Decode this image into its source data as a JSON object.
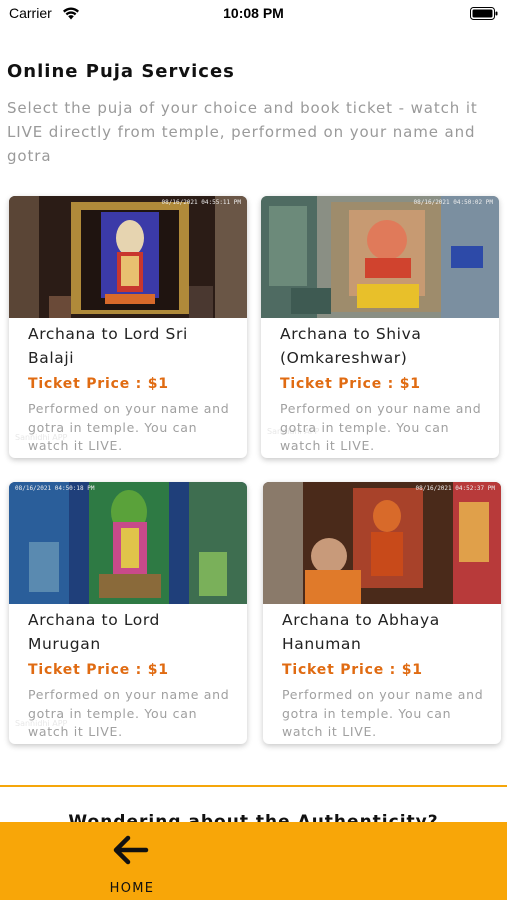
{
  "status_bar": {
    "carrier": "Carrier",
    "time": "10:08 PM"
  },
  "header": {
    "title": "Online Puja Services",
    "subtitle": "Select the puja of your choice and book ticket - watch it LIVE directly from temple, performed on your name and gotra"
  },
  "cards": [
    {
      "title": "Archana to Lord Sri Balaji",
      "price": "Ticket Price : $1",
      "description": "Performed on your name and gotra in temple. You can watch it LIVE.",
      "camera_stamp": "08/16/2021 04:55:11 PM",
      "camera_brand": "Sannidhi APP"
    },
    {
      "title": "Archana to Shiva (Omkareshwar)",
      "price": "Ticket Price : $1",
      "description": "Performed on your name and gotra in temple. You can watch it LIVE.",
      "camera_stamp": "08/16/2021 04:50:02 PM",
      "camera_brand": "Sannidhi APP"
    },
    {
      "title": "Archana to Lord Murugan",
      "price": "Ticket Price : $1",
      "description": "Performed on your name and gotra in temple. You can watch it LIVE.",
      "camera_stamp": "08/16/2021 04:50:18 PM",
      "camera_brand": "Sannidhi APP"
    },
    {
      "title": "Archana to Abhaya Hanuman",
      "price": "Ticket Price : $1",
      "description": "Performed on your name and gotra in temple. You can watch it LIVE.",
      "camera_stamp": "08/16/2021 04:52:37 PM",
      "camera_brand": ""
    }
  ],
  "section_peek": "Wondering about the Authenticity?",
  "bottom_bar": {
    "home_label": "HOME"
  },
  "colors": {
    "accent": "#f8a608",
    "price": "#e06b12",
    "divider": "#f5a60a"
  },
  "icons": {
    "wifi": "wifi-icon",
    "battery": "battery-icon",
    "home": "arrow-left-icon"
  }
}
